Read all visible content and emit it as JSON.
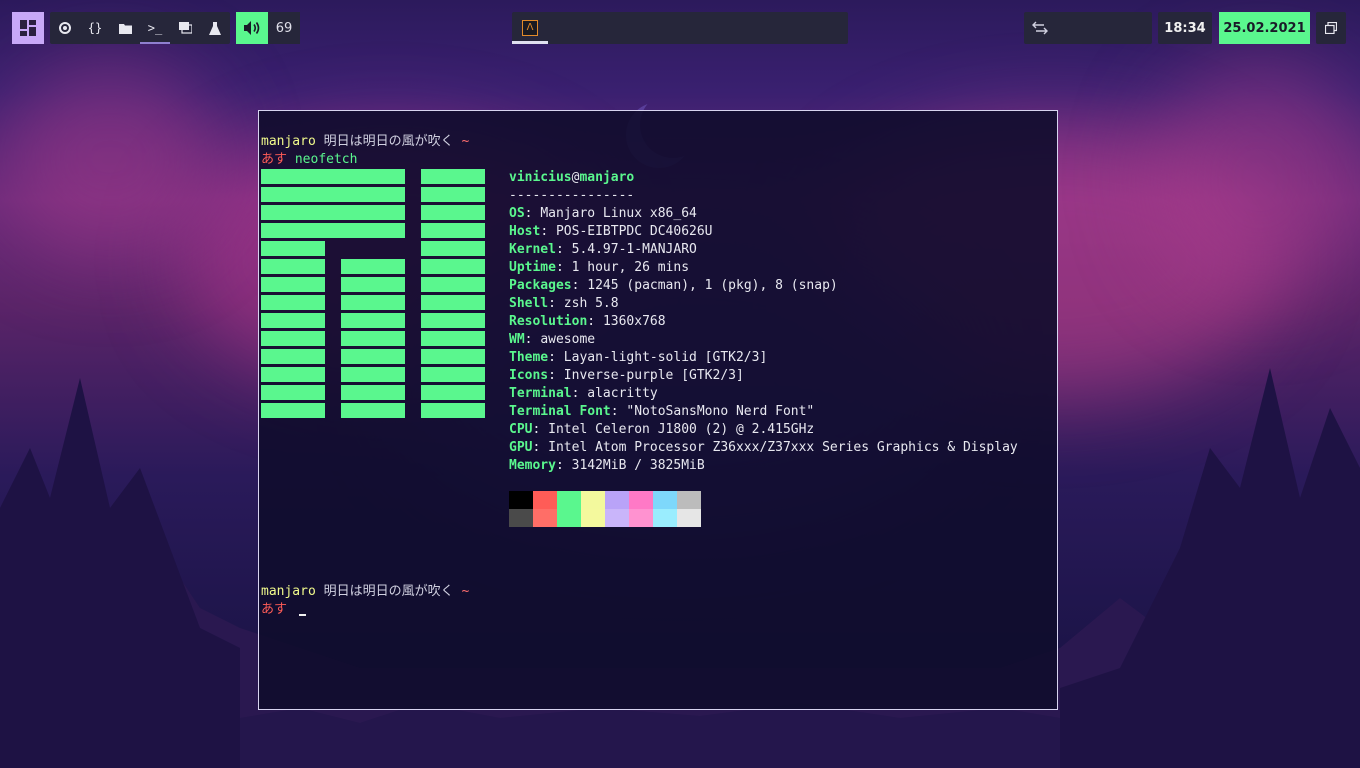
{
  "topbar": {
    "tags": [
      {
        "icon": "firefox-icon",
        "glyph": "◕"
      },
      {
        "icon": "code-icon",
        "glyph": "{}"
      },
      {
        "icon": "folder-icon",
        "glyph": "▬"
      },
      {
        "icon": "terminal-icon",
        "glyph": ">_"
      },
      {
        "icon": "chat-icon",
        "glyph": "▤"
      },
      {
        "icon": "flask-icon",
        "glyph": "⚗"
      }
    ],
    "active_tag": 3,
    "volume": "69",
    "task_icon_glyph": "Λ",
    "clock": "18:34",
    "date": "25.02.2021"
  },
  "terminal": {
    "prompt1_user": "manjaro",
    "prompt1_rest": " 明日は明日の風が吹く",
    "prompt1_path": " ~",
    "cmd_prefix": "あす",
    "command": " neofetch",
    "prompt2_user": "manjaro",
    "prompt2_rest": " 明日は明日の風が吹く",
    "prompt2_path": " ~",
    "cmd_prefix2": "あす",
    "neofetch": {
      "user": "vinicius",
      "at": "@",
      "host": "manjaro",
      "separator": "----------------",
      "fields": [
        {
          "key": "OS",
          "value": "Manjaro Linux x86_64"
        },
        {
          "key": "Host",
          "value": "POS-EIBTPDC DC40626U"
        },
        {
          "key": "Kernel",
          "value": "5.4.97-1-MANJARO"
        },
        {
          "key": "Uptime",
          "value": "1 hour, 26 mins"
        },
        {
          "key": "Packages",
          "value": "1245 (pacman), 1 (pkg), 8 (snap)"
        },
        {
          "key": "Shell",
          "value": "zsh 5.8"
        },
        {
          "key": "Resolution",
          "value": "1360x768"
        },
        {
          "key": "WM",
          "value": "awesome"
        },
        {
          "key": "Theme",
          "value": "Layan-light-solid [GTK2/3]"
        },
        {
          "key": "Icons",
          "value": "Inverse-purple [GTK2/3]"
        },
        {
          "key": "Terminal",
          "value": "alacritty"
        },
        {
          "key": "Terminal Font",
          "value": "\"NotoSansMono Nerd Font\""
        },
        {
          "key": "CPU",
          "value": "Intel Celeron J1800 (2) @ 2.415GHz"
        },
        {
          "key": "GPU",
          "value": "Intel Atom Processor Z36xxx/Z37xxx Series Graphics & Display"
        },
        {
          "key": "Memory",
          "value": "3142MiB / 3825MiB"
        }
      ],
      "palette_top": [
        "#000000",
        "#ff5c57",
        "#5af78e",
        "#f3f99d",
        "#b9a3f8",
        "#ff79c6",
        "#7ed8fb",
        "#bcbcbc"
      ],
      "palette_bottom": [
        "#4a4a4a",
        "#ff6e67",
        "#5af78e",
        "#f4f99d",
        "#c9b5fa",
        "#ff92d0",
        "#9aedfe",
        "#e6e6e6"
      ]
    }
  }
}
